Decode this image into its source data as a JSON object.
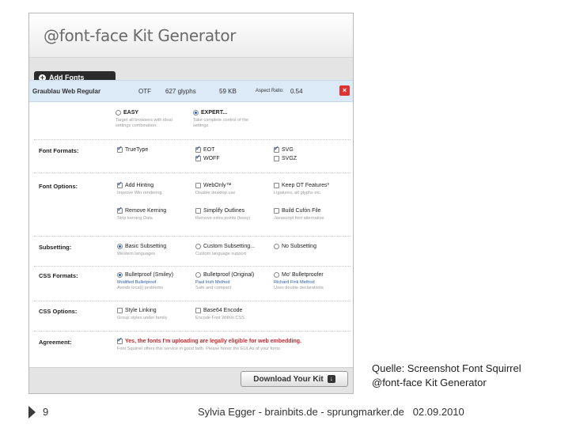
{
  "app": {
    "title": "@font-face Kit Generator",
    "add_fonts_label": "Add Fonts"
  },
  "font_row": {
    "name": "Graublau Web Regular",
    "format": "OTF",
    "glyphs": "627 glyphs",
    "size": "59 KB",
    "aspect_label": "Aspect Ratio:",
    "aspect_value": "0.54",
    "close_glyph": "×"
  },
  "modes": {
    "easy": {
      "label": "EASY",
      "desc1": "Target all browsers with ideal",
      "desc2": "settings combination."
    },
    "expert": {
      "label": "EXPERT...",
      "desc1": "Take complete control of the",
      "desc2": "settings."
    }
  },
  "font_formats": {
    "label": "Font Formats:",
    "truetype": "TrueType",
    "eot": "EOT",
    "woff": "WOFF",
    "svg": "SVG",
    "svgz": "SVGZ"
  },
  "font_options": {
    "label": "Font Options:",
    "add_hinting": "Add Hinting",
    "add_hinting_desc": "Improve Win rendering",
    "webonly": "WebOnly™",
    "webonly_desc": "Disable desktop use",
    "keep_ot": "Keep OT Features*",
    "keep_ot_desc": "Ligatures, alt glyphs etc.",
    "remove_kerning": "Remove Kerning",
    "remove_kerning_desc": "Strip kerning Data",
    "simplify": "Simplify Outlines",
    "simplify_desc": "Remove extra points (lossy)",
    "cufon": "Build Cufón File",
    "cufon_desc": "Javascript font alternative"
  },
  "subsetting": {
    "label": "Subsetting:",
    "basic": "Basic Subsetting",
    "basic_desc": "Western languages",
    "custom": "Custom Subsetting...",
    "custom_desc": "Custom language support",
    "none": "No Subsetting"
  },
  "css_formats": {
    "label": "CSS Formats:",
    "smiley": "Bulletproof (Smiley)",
    "smiley_link": "Modified Bulletproof",
    "smiley_desc": "Avoids local() problems",
    "original": "Bulletproof (Original)",
    "original_link": "Paul Irish Method",
    "original_desc": "Safe and compact",
    "mo": "Mo' Bulletproofer",
    "mo_link": "Richard Fink Method",
    "mo_desc": "Uses double declarations"
  },
  "css_options": {
    "label": "CSS Options:",
    "style_linking": "Style Linking",
    "style_linking_desc": "Group styles under family",
    "base64": "Base64 Encode",
    "base64_desc": "Encode Font Within CSS"
  },
  "agreement": {
    "label": "Agreement:",
    "text": "Yes, the fonts I'm uploading are legally eligible for web embedding.",
    "desc": "Font Squirrel offers this service in good faith. Please honor the EULAs of your fonts."
  },
  "download_label": "Download Your Kit",
  "caption": {
    "line1": "Quelle: Screenshot Font Squirrel",
    "line2": "@font-face Kit Generator"
  },
  "slide": {
    "number": "9",
    "author": "Sylvia Egger - brainbits.de - sprungmarker.de",
    "date": "02.09.2010"
  },
  "colors": {
    "close": "#dd3333",
    "link": "#2a5db0",
    "agreement": "#c0282d",
    "fontbar": "#dce9f6"
  }
}
